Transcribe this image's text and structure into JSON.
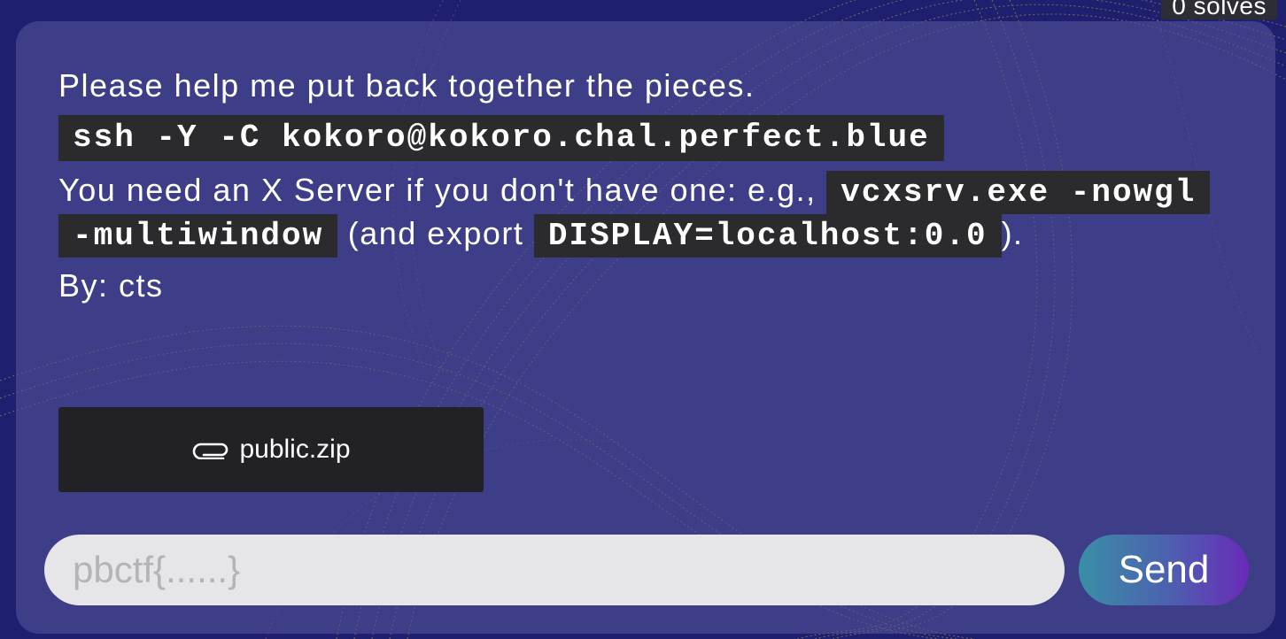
{
  "header": {
    "solves_label": "0 solves"
  },
  "challenge": {
    "line1": "Please help me put back together the pieces.",
    "ssh_command": "ssh -Y -C kokoro@kokoro.chal.perfect.blue",
    "xserver_text_before": "You need an X Server if you don't have one: e.g., ",
    "xserver_command": "vcxsrv.exe -nowgl -multiwindow",
    "xserver_text_middle": " (and export ",
    "display_command": "DISPLAY=localhost:0.0",
    "xserver_text_after": ").",
    "author": "By: cts"
  },
  "attachment": {
    "icon": "paperclip-icon",
    "filename": "public.zip"
  },
  "flag_form": {
    "placeholder": "pbctf{......}",
    "value": "",
    "submit_label": "Send"
  },
  "colors": {
    "background": "#1e1f6e",
    "card": "#524f96",
    "code_bg": "#2b2b2e",
    "file_button_bg": "#222226",
    "input_bg": "#e6e6e8",
    "send_gradient_start": "#3a8ea6",
    "send_gradient_end": "#6a2ab8"
  }
}
